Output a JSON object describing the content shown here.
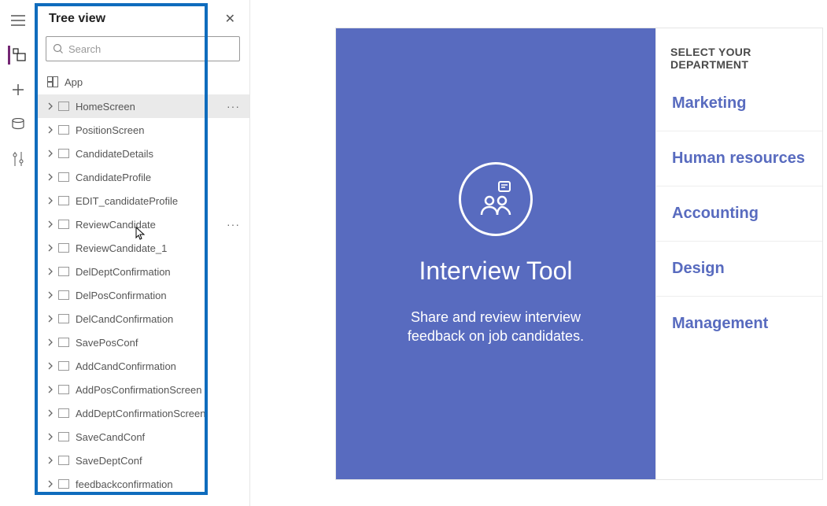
{
  "tree": {
    "title": "Tree view",
    "search_placeholder": "Search",
    "app_label": "App",
    "screens": [
      {
        "label": "HomeScreen",
        "selected": true,
        "more": true
      },
      {
        "label": "PositionScreen"
      },
      {
        "label": "CandidateDetails"
      },
      {
        "label": "CandidateProfile"
      },
      {
        "label": "EDIT_candidateProfile"
      },
      {
        "label": "ReviewCandidate",
        "more": true
      },
      {
        "label": "ReviewCandidate_1"
      },
      {
        "label": "DelDeptConfirmation"
      },
      {
        "label": "DelPosConfirmation"
      },
      {
        "label": "DelCandConfirmation"
      },
      {
        "label": "SavePosConf"
      },
      {
        "label": "AddCandConfirmation"
      },
      {
        "label": "AddPosConfirmationScreen"
      },
      {
        "label": "AddDeptConfirmationScreen"
      },
      {
        "label": "SaveCandConf"
      },
      {
        "label": "SaveDeptConf"
      },
      {
        "label": "feedbackconfirmation"
      }
    ]
  },
  "preview": {
    "title": "Interview Tool",
    "subtitle": "Share and review interview feedback on job candidates.",
    "dept_header": "SELECT YOUR DEPARTMENT",
    "departments": [
      "Marketing",
      "Human resources",
      "Accounting",
      "Design",
      "Management"
    ]
  }
}
